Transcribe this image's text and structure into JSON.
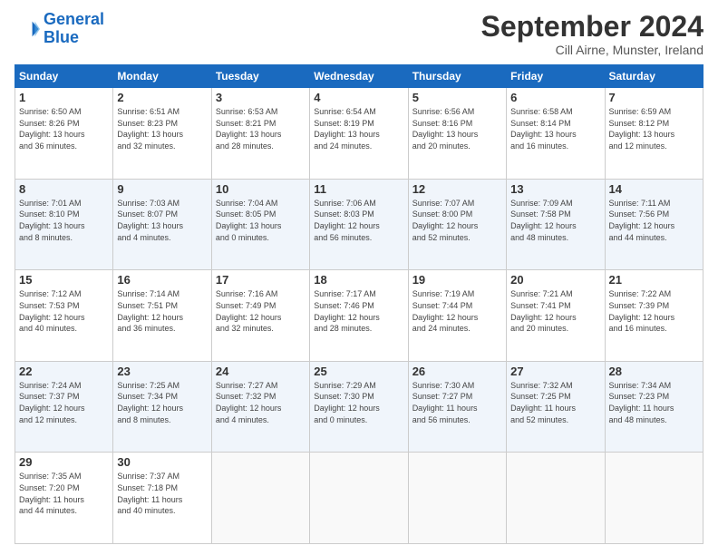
{
  "header": {
    "logo_line1": "General",
    "logo_line2": "Blue",
    "month_title": "September 2024",
    "subtitle": "Cill Airne, Munster, Ireland"
  },
  "weekdays": [
    "Sunday",
    "Monday",
    "Tuesday",
    "Wednesday",
    "Thursday",
    "Friday",
    "Saturday"
  ],
  "weeks": [
    [
      {
        "day": "1",
        "info": "Sunrise: 6:50 AM\nSunset: 8:26 PM\nDaylight: 13 hours\nand 36 minutes."
      },
      {
        "day": "2",
        "info": "Sunrise: 6:51 AM\nSunset: 8:23 PM\nDaylight: 13 hours\nand 32 minutes."
      },
      {
        "day": "3",
        "info": "Sunrise: 6:53 AM\nSunset: 8:21 PM\nDaylight: 13 hours\nand 28 minutes."
      },
      {
        "day": "4",
        "info": "Sunrise: 6:54 AM\nSunset: 8:19 PM\nDaylight: 13 hours\nand 24 minutes."
      },
      {
        "day": "5",
        "info": "Sunrise: 6:56 AM\nSunset: 8:16 PM\nDaylight: 13 hours\nand 20 minutes."
      },
      {
        "day": "6",
        "info": "Sunrise: 6:58 AM\nSunset: 8:14 PM\nDaylight: 13 hours\nand 16 minutes."
      },
      {
        "day": "7",
        "info": "Sunrise: 6:59 AM\nSunset: 8:12 PM\nDaylight: 13 hours\nand 12 minutes."
      }
    ],
    [
      {
        "day": "8",
        "info": "Sunrise: 7:01 AM\nSunset: 8:10 PM\nDaylight: 13 hours\nand 8 minutes."
      },
      {
        "day": "9",
        "info": "Sunrise: 7:03 AM\nSunset: 8:07 PM\nDaylight: 13 hours\nand 4 minutes."
      },
      {
        "day": "10",
        "info": "Sunrise: 7:04 AM\nSunset: 8:05 PM\nDaylight: 13 hours\nand 0 minutes."
      },
      {
        "day": "11",
        "info": "Sunrise: 7:06 AM\nSunset: 8:03 PM\nDaylight: 12 hours\nand 56 minutes."
      },
      {
        "day": "12",
        "info": "Sunrise: 7:07 AM\nSunset: 8:00 PM\nDaylight: 12 hours\nand 52 minutes."
      },
      {
        "day": "13",
        "info": "Sunrise: 7:09 AM\nSunset: 7:58 PM\nDaylight: 12 hours\nand 48 minutes."
      },
      {
        "day": "14",
        "info": "Sunrise: 7:11 AM\nSunset: 7:56 PM\nDaylight: 12 hours\nand 44 minutes."
      }
    ],
    [
      {
        "day": "15",
        "info": "Sunrise: 7:12 AM\nSunset: 7:53 PM\nDaylight: 12 hours\nand 40 minutes."
      },
      {
        "day": "16",
        "info": "Sunrise: 7:14 AM\nSunset: 7:51 PM\nDaylight: 12 hours\nand 36 minutes."
      },
      {
        "day": "17",
        "info": "Sunrise: 7:16 AM\nSunset: 7:49 PM\nDaylight: 12 hours\nand 32 minutes."
      },
      {
        "day": "18",
        "info": "Sunrise: 7:17 AM\nSunset: 7:46 PM\nDaylight: 12 hours\nand 28 minutes."
      },
      {
        "day": "19",
        "info": "Sunrise: 7:19 AM\nSunset: 7:44 PM\nDaylight: 12 hours\nand 24 minutes."
      },
      {
        "day": "20",
        "info": "Sunrise: 7:21 AM\nSunset: 7:41 PM\nDaylight: 12 hours\nand 20 minutes."
      },
      {
        "day": "21",
        "info": "Sunrise: 7:22 AM\nSunset: 7:39 PM\nDaylight: 12 hours\nand 16 minutes."
      }
    ],
    [
      {
        "day": "22",
        "info": "Sunrise: 7:24 AM\nSunset: 7:37 PM\nDaylight: 12 hours\nand 12 minutes."
      },
      {
        "day": "23",
        "info": "Sunrise: 7:25 AM\nSunset: 7:34 PM\nDaylight: 12 hours\nand 8 minutes."
      },
      {
        "day": "24",
        "info": "Sunrise: 7:27 AM\nSunset: 7:32 PM\nDaylight: 12 hours\nand 4 minutes."
      },
      {
        "day": "25",
        "info": "Sunrise: 7:29 AM\nSunset: 7:30 PM\nDaylight: 12 hours\nand 0 minutes."
      },
      {
        "day": "26",
        "info": "Sunrise: 7:30 AM\nSunset: 7:27 PM\nDaylight: 11 hours\nand 56 minutes."
      },
      {
        "day": "27",
        "info": "Sunrise: 7:32 AM\nSunset: 7:25 PM\nDaylight: 11 hours\nand 52 minutes."
      },
      {
        "day": "28",
        "info": "Sunrise: 7:34 AM\nSunset: 7:23 PM\nDaylight: 11 hours\nand 48 minutes."
      }
    ],
    [
      {
        "day": "29",
        "info": "Sunrise: 7:35 AM\nSunset: 7:20 PM\nDaylight: 11 hours\nand 44 minutes."
      },
      {
        "day": "30",
        "info": "Sunrise: 7:37 AM\nSunset: 7:18 PM\nDaylight: 11 hours\nand 40 minutes."
      },
      {
        "day": "",
        "info": ""
      },
      {
        "day": "",
        "info": ""
      },
      {
        "day": "",
        "info": ""
      },
      {
        "day": "",
        "info": ""
      },
      {
        "day": "",
        "info": ""
      }
    ]
  ]
}
